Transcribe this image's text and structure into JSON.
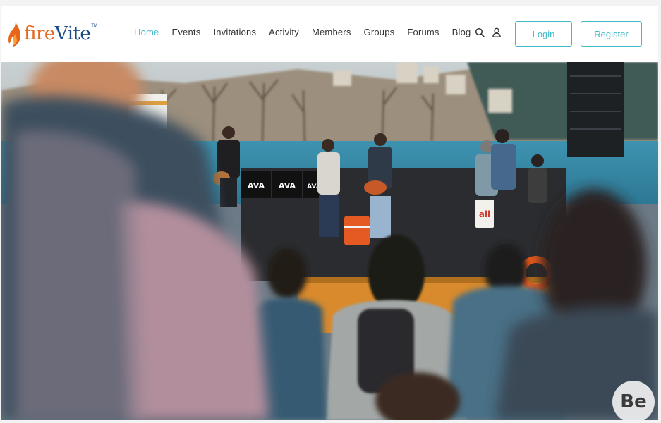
{
  "brand": {
    "logo_part1": "fire",
    "logo_part2": "Vite",
    "logo_tm": "TM",
    "colors": {
      "fire": "#e8651b",
      "vite": "#1a4a8a",
      "accent": "#3fb9c8"
    }
  },
  "nav": {
    "items": [
      {
        "label": "Home",
        "active": true
      },
      {
        "label": "Events"
      },
      {
        "label": "Invitations"
      },
      {
        "label": "Activity"
      },
      {
        "label": "Members"
      },
      {
        "label": "Groups"
      },
      {
        "label": "Forums"
      },
      {
        "label": "Blog"
      }
    ],
    "icons": [
      "search-icon",
      "user-icon"
    ]
  },
  "buttons": {
    "login": "Login",
    "register": "Register"
  },
  "hero": {
    "stage_signs": [
      "AVA",
      "AVA",
      "AVA"
    ],
    "stage_sign_small": "ail"
  },
  "watermark": {
    "text": "Be"
  }
}
